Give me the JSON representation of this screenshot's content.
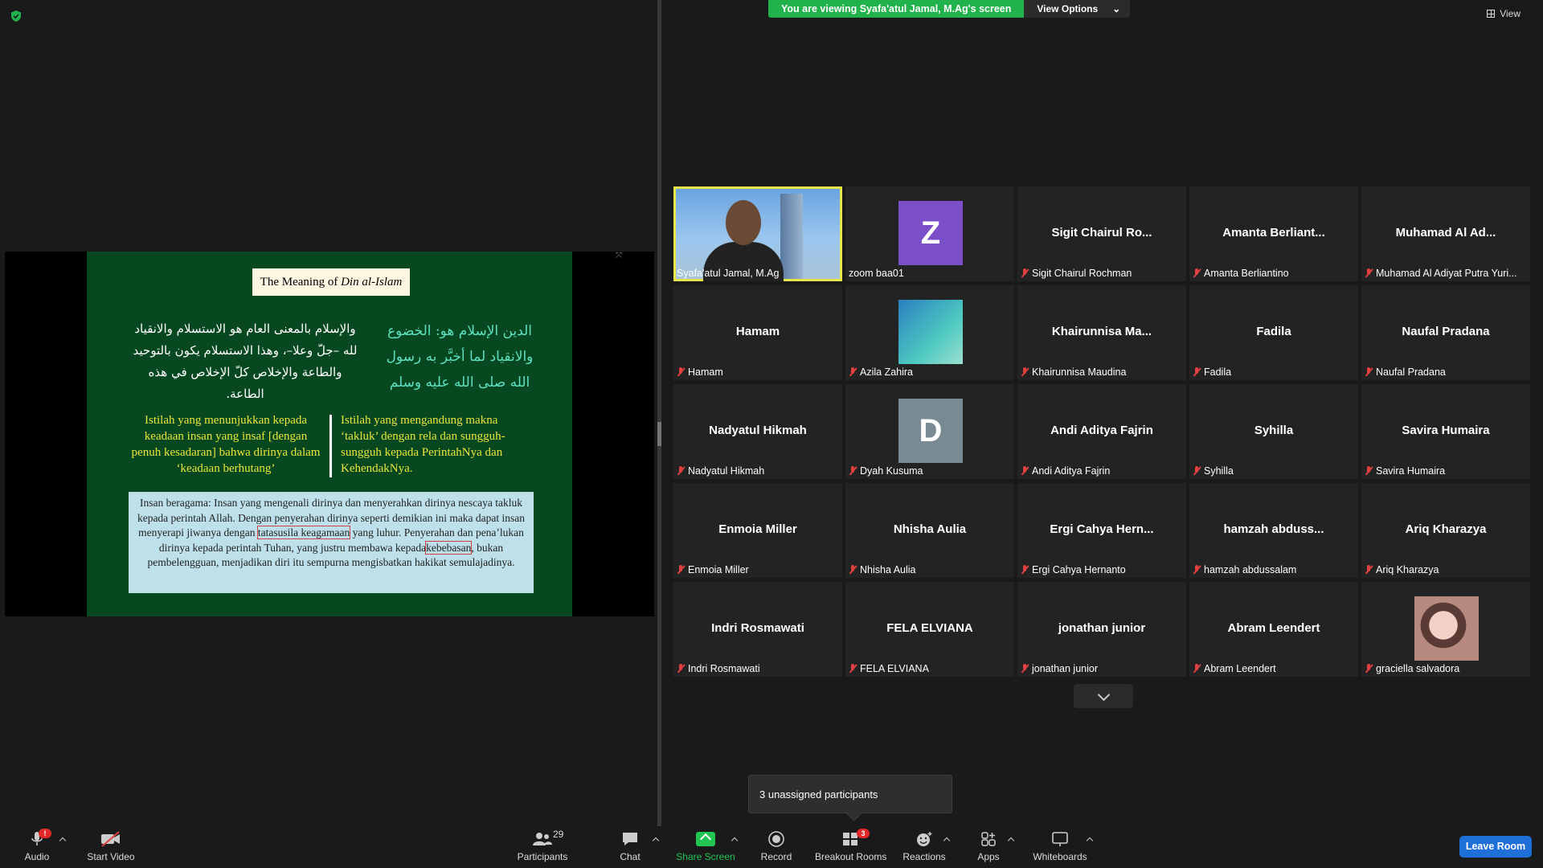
{
  "banner": {
    "viewing_text": "You are viewing Syafa'atul Jamal, M.Ag's screen",
    "options_label": "View Options"
  },
  "view_label": "View",
  "slide": {
    "title_prefix": "The Meaning of ",
    "title_italic": "Din al-Islam",
    "arabic_left": "والإسلام بالمعنى العام هو الاستسلام والانقياد لله –جلّ وعلا–، وهذا الاستسلام يكون بالتوحيد والطاعة والإخلاص كلّ الإخلاص في هذه الطاعة.",
    "arabic_right": "الدين الإسلام هو: الخضوع والانقياد لما أخبَّر به رسول الله صلى الله عليه وسلم",
    "id_left": "Istilah yang menunjukkan kepada keadaan insan yang insaf [dengan penuh kesadaran] bahwa dirinya dalam ‘keadaan berhutang’",
    "id_right": "Istilah yang mengandung makna ‘takluk’ dengan rela dan sungguh-sungguh kepada PerintahNya dan KehendakNya.",
    "box_part1": "Insan beragama: Insan yang mengenali dirinya dan menyerahkan dirinya nescaya takluk kepada perintah Allah. Dengan penyerahan dirinya seperti demikian ini maka dapat insan menyerapi jiwanya dengan ",
    "box_hl1": "tatasusila keagamaan",
    "box_part2": " yang luhur. Penyerahan dan pena’lukan dirinya kepada perintah Tuhan, yang justru membawa kepada",
    "box_hl2": "kebebasan",
    "box_part3": ", bukan pembelengguan, menjadikan diri itu sempurna mengisbatkan hakikat semulajadinya."
  },
  "participants": [
    {
      "big": "",
      "caption": "Syafa'atul Jamal, M.Ag",
      "type": "video",
      "muted": false
    },
    {
      "big": "Z",
      "caption": "zoom baa01",
      "type": "avatar-z",
      "muted": false
    },
    {
      "big": "Sigit  Chairul  Ro...",
      "caption": "Sigit Chairul Rochman",
      "type": "name",
      "muted": true
    },
    {
      "big": "Amanta  Berliant...",
      "caption": "Amanta Berliantino",
      "type": "name",
      "muted": true
    },
    {
      "big": "Muhamad  Al  Ad...",
      "caption": "Muhamad Al Adiyat Putra Yuri...",
      "type": "name",
      "muted": true
    },
    {
      "big": "Hamam",
      "caption": "Hamam",
      "type": "name",
      "muted": true
    },
    {
      "big": "",
      "caption": "Azila Zahira",
      "type": "avatar-img1",
      "muted": true
    },
    {
      "big": "Khairunnisa  Ma...",
      "caption": "Khairunnisa Maudina",
      "type": "name",
      "muted": true
    },
    {
      "big": "Fadila",
      "caption": "Fadila",
      "type": "name",
      "muted": true
    },
    {
      "big": "Naufal Pradana",
      "caption": "Naufal Pradana",
      "type": "name",
      "muted": true
    },
    {
      "big": "Nadyatul Hikmah",
      "caption": "Nadyatul Hikmah",
      "type": "name",
      "muted": true
    },
    {
      "big": "D",
      "caption": "Dyah Kusuma",
      "type": "avatar-d",
      "muted": true
    },
    {
      "big": "Andi Aditya Fajrin",
      "caption": "Andi Aditya Fajrin",
      "type": "name",
      "muted": true
    },
    {
      "big": "Syhilla",
      "caption": "Syhilla",
      "type": "name",
      "muted": true
    },
    {
      "big": "Savira Humaira",
      "caption": "Savira Humaira",
      "type": "name",
      "muted": true
    },
    {
      "big": "Enmoia Miller",
      "caption": "Enmoia Miller",
      "type": "name",
      "muted": true
    },
    {
      "big": "Nhisha Aulia",
      "caption": "Nhisha Aulia",
      "type": "name",
      "muted": true
    },
    {
      "big": "Ergi  Cahya  Hern...",
      "caption": "Ergi Cahya Hernanto",
      "type": "name",
      "muted": true
    },
    {
      "big": "hamzah  abduss...",
      "caption": "hamzah abdussalam",
      "type": "name",
      "muted": true
    },
    {
      "big": "Ariq Kharazya",
      "caption": "Ariq Kharazya",
      "type": "name",
      "muted": true
    },
    {
      "big": "Indri Rosmawati",
      "caption": "Indri Rosmawati",
      "type": "name",
      "muted": true
    },
    {
      "big": "FELA ELVIANA",
      "caption": "FELA ELVIANA",
      "type": "name",
      "muted": true
    },
    {
      "big": "jonathan junior",
      "caption": "jonathan junior",
      "type": "name",
      "muted": true
    },
    {
      "big": "Abram Leendert",
      "caption": "Abram Leendert",
      "type": "name",
      "muted": true
    },
    {
      "big": "",
      "caption": "graciella salvadora",
      "type": "avatar-img2",
      "muted": true
    }
  ],
  "tooltip": "3 unassigned participants",
  "toolbar": {
    "audio": "Audio",
    "audio_badge": "!",
    "start_video": "Start Video",
    "participants": "Participants",
    "participants_count": "29",
    "chat": "Chat",
    "share_screen": "Share Screen",
    "record": "Record",
    "breakout_rooms": "Breakout Rooms",
    "breakout_badge": "3",
    "reactions": "Reactions",
    "apps": "Apps",
    "whiteboards": "Whiteboards",
    "leave": "Leave Room"
  },
  "colors": {
    "share_green": "#22b24c",
    "active_speaker": "#e8e54a",
    "leave_blue": "#1e6fd8",
    "slide_green": "#084820"
  }
}
